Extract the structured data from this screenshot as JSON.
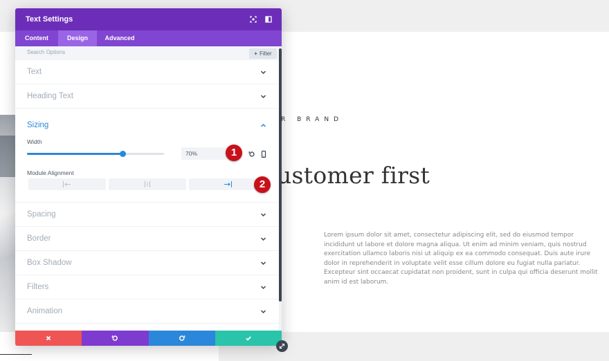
{
  "background": {
    "brand_text": "R  BRAND",
    "headline": "ustomer first",
    "body_text": "Lorem ipsum dolor sit amet, consectetur adipiscing elit, sed do eiusmod tempor incididunt ut labore et dolore magna aliqua. Ut enim ad minim veniam, quis nostrud exercitation ullamco laboris nisi ut aliquip ex ea commodo consequat. Duis aute irure dolor in reprehenderit in voluptate velit esse cillum dolore eu fugiat nulla pariatur. Excepteur sint occaecat cupidatat non proident, sunt in culpa qui officia deserunt mollit anim id est laborum."
  },
  "modal": {
    "title": "Text Settings",
    "header_icons": [
      "focus-icon",
      "split-view-icon"
    ],
    "tabs": [
      {
        "label": "Content",
        "active": false
      },
      {
        "label": "Design",
        "active": true
      },
      {
        "label": "Advanced",
        "active": false
      }
    ],
    "search": {
      "placeholder": "Search Options",
      "filter_label": "Filter"
    },
    "groups_before": [
      {
        "label": "Text"
      },
      {
        "label": "Heading Text"
      }
    ],
    "open_group": {
      "label": "Sizing",
      "width_label": "Width",
      "width_value": "70%",
      "slider_fraction": 0.7,
      "alignment_label": "Module Alignment",
      "alignment_options": [
        "left",
        "center",
        "right"
      ],
      "alignment_selected": "right"
    },
    "groups_after": [
      {
        "label": "Spacing"
      },
      {
        "label": "Border"
      },
      {
        "label": "Box Shadow"
      },
      {
        "label": "Filters"
      },
      {
        "label": "Animation"
      }
    ],
    "footer": [
      {
        "action": "discard",
        "icon": "x-icon",
        "color": "#ef5555"
      },
      {
        "action": "undo",
        "icon": "undo-icon",
        "color": "#7e3bd0"
      },
      {
        "action": "redo",
        "icon": "redo-icon",
        "color": "#2b87da"
      },
      {
        "action": "save",
        "icon": "check-icon",
        "color": "#29c4a9"
      }
    ]
  },
  "annotations": [
    "1",
    "2"
  ],
  "colors": {
    "header": "#6c2eb9",
    "tabs": "#8045d1",
    "active_tab": "#9a64e6",
    "accent_blue": "#2b87da",
    "badge_red": "#c8111a"
  }
}
